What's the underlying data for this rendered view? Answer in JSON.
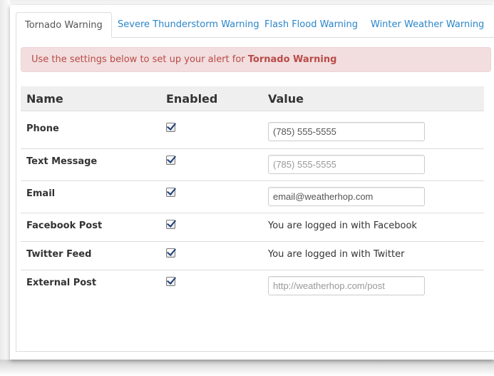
{
  "tabs": [
    {
      "label": "Tornado Warning",
      "active": true
    },
    {
      "label": "Severe Thunderstorm Warning",
      "active": false
    },
    {
      "label": "Flash Flood Warning",
      "active": false
    },
    {
      "label": "Winter Weather Warning",
      "active": false
    }
  ],
  "alert": {
    "prefix": "Use the settings below to set up your alert for ",
    "highlight": "Tornado Warning"
  },
  "table": {
    "headers": {
      "name": "Name",
      "enabled": "Enabled",
      "value": "Value"
    },
    "rows": [
      {
        "name": "Phone",
        "enabled": true,
        "value": "(785) 555-5555",
        "placeholder": ""
      },
      {
        "name": "Text Message",
        "enabled": true,
        "value": "",
        "placeholder": "(785) 555-5555"
      },
      {
        "name": "Email",
        "enabled": true,
        "value": "email@weatherhop.com",
        "placeholder": ""
      },
      {
        "name": "Facebook Post",
        "enabled": true,
        "text": "You are logged in with Facebook"
      },
      {
        "name": "Twitter Feed",
        "enabled": true,
        "text": "You are logged in with Twitter"
      },
      {
        "name": "External Post",
        "enabled": true,
        "value": "",
        "placeholder": "http://weatherhop.com/post"
      }
    ]
  },
  "colors": {
    "link": "#2a86c9",
    "alert_bg": "#f2dede",
    "alert_text": "#b94a48",
    "header_bg": "#efefef"
  }
}
